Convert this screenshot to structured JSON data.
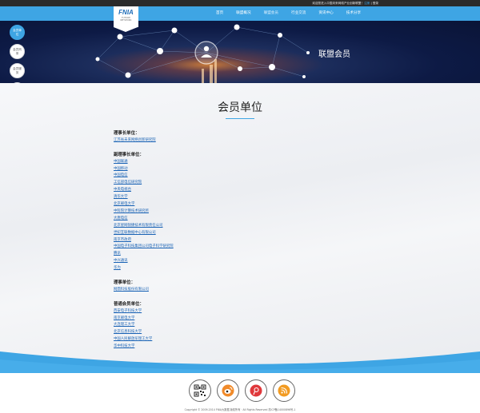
{
  "topbar": {
    "welcome": "欢迎您进入中国未来网络产业创新联盟！",
    "register_label": "注册",
    "separator": "|",
    "login_label": "登录"
  },
  "logo": {
    "mark": "FNIA",
    "tagline": "FUTURE NETWORK"
  },
  "nav": {
    "items": [
      {
        "label": "首页"
      },
      {
        "label": "联盟概况"
      },
      {
        "label": "联盟会员"
      },
      {
        "label": "行业交流"
      },
      {
        "label": "资讯中心"
      },
      {
        "label": "技术分享"
      }
    ],
    "active_index": 2
  },
  "banner": {
    "title": "联盟会员"
  },
  "sidenav": {
    "items": [
      {
        "label": "会员单位"
      },
      {
        "label": "会员风采"
      },
      {
        "label": "会员服务"
      },
      {
        "label": "会员申请"
      }
    ]
  },
  "page": {
    "title": "会员单位"
  },
  "sections": [
    {
      "heading": "理事长单位：",
      "links": [
        "江苏省未来网络创新研究院"
      ]
    },
    {
      "heading": "副理事长单位：",
      "links": [
        "中国联通",
        "中国移动",
        "中国电信",
        "工信部电信研究院",
        "中央电视台",
        "清华大学",
        "北京邮电大学",
        "中科院计算技术研究所",
        "大唐电信",
        "北京星网锐捷技术有限责任公司",
        "世纪互联数据中心有限公司",
        "南京市政府",
        "中国电子科技集团公司电子科学研究院",
        "腾讯",
        "中兴通讯",
        "华为"
      ]
    },
    {
      "heading": "理事单位：",
      "links": [
        "网鼎科技股份有限公司"
      ]
    },
    {
      "heading": "普通会员单位：",
      "links": [
        "西安电子科技大学",
        "南京邮电大学",
        "大连理工大学",
        "北京信息科技大学",
        "中国人民解放军理工大学",
        "华中科技大学"
      ]
    }
  ],
  "footer": {
    "icons": [
      "qr-code-icon",
      "weibo-icon",
      "tencent-weibo-icon",
      "rss-icon"
    ],
    "copyright": "Copyright © 2009-2014 FNIA大数据 版权所有 · All Rights Reserved  苏ICP备14000896号-1"
  },
  "colors": {
    "accent": "#3ea5e4",
    "link": "#1a63b5",
    "topbar": "#2b2b2b"
  }
}
